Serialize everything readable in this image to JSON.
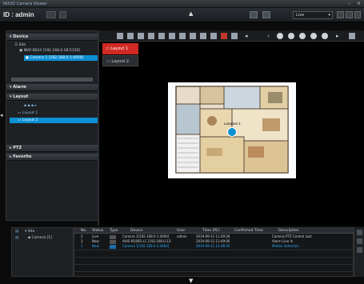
{
  "window": {
    "title": "NUUO Camera Viewer"
  },
  "header": {
    "id_label": "ID : admin",
    "view_select": "Live"
  },
  "left_panel": {
    "device": {
      "title": "Device",
      "items": [
        "Site",
        "NVR 8024 [192.168.0.28:5150]",
        "Camera 1 [192.168.0.1:4000]"
      ]
    },
    "alarm": {
      "title": "Alarm"
    },
    "layout": {
      "title": "Layout",
      "items": [
        "Layout 1",
        "Layout 2"
      ]
    },
    "ptz": {
      "title": "PTZ"
    },
    "favorite": {
      "title": "Favorite"
    }
  },
  "tabs": [
    {
      "label": "Layout 1"
    },
    {
      "label": "Layout 2"
    }
  ],
  "map": {
    "marker_label": "Location 1"
  },
  "bottom_left": {
    "items": [
      "Site",
      "Camera [1]"
    ]
  },
  "event_table": {
    "columns": [
      "No.",
      "Status",
      "Type",
      "Device",
      "User",
      "Time (PC)",
      "Confirmed Time",
      "Description"
    ],
    "rows": [
      [
        "2",
        "Live",
        "",
        "Camera 1[192.168.0.1:4000]",
        "admin",
        "2019-09-11 11:49:28",
        "",
        "Camera PTZ Control Lost"
      ],
      [
        "2",
        "New",
        "",
        "AXIS M1065-LC [192.168.0.12:...",
        "",
        "2019-09-11 11:49:06",
        "",
        "Alarm Line In"
      ],
      [
        "1",
        "New",
        "",
        "Camera 1[192.168.0.1:4000]",
        "",
        "2019-09-11 11:48:56",
        "",
        "Motion detection"
      ]
    ]
  },
  "colors": {
    "accent": "#0d8fd3",
    "tab_active": "#d12a24",
    "selected_text": "#2ab0ff"
  }
}
